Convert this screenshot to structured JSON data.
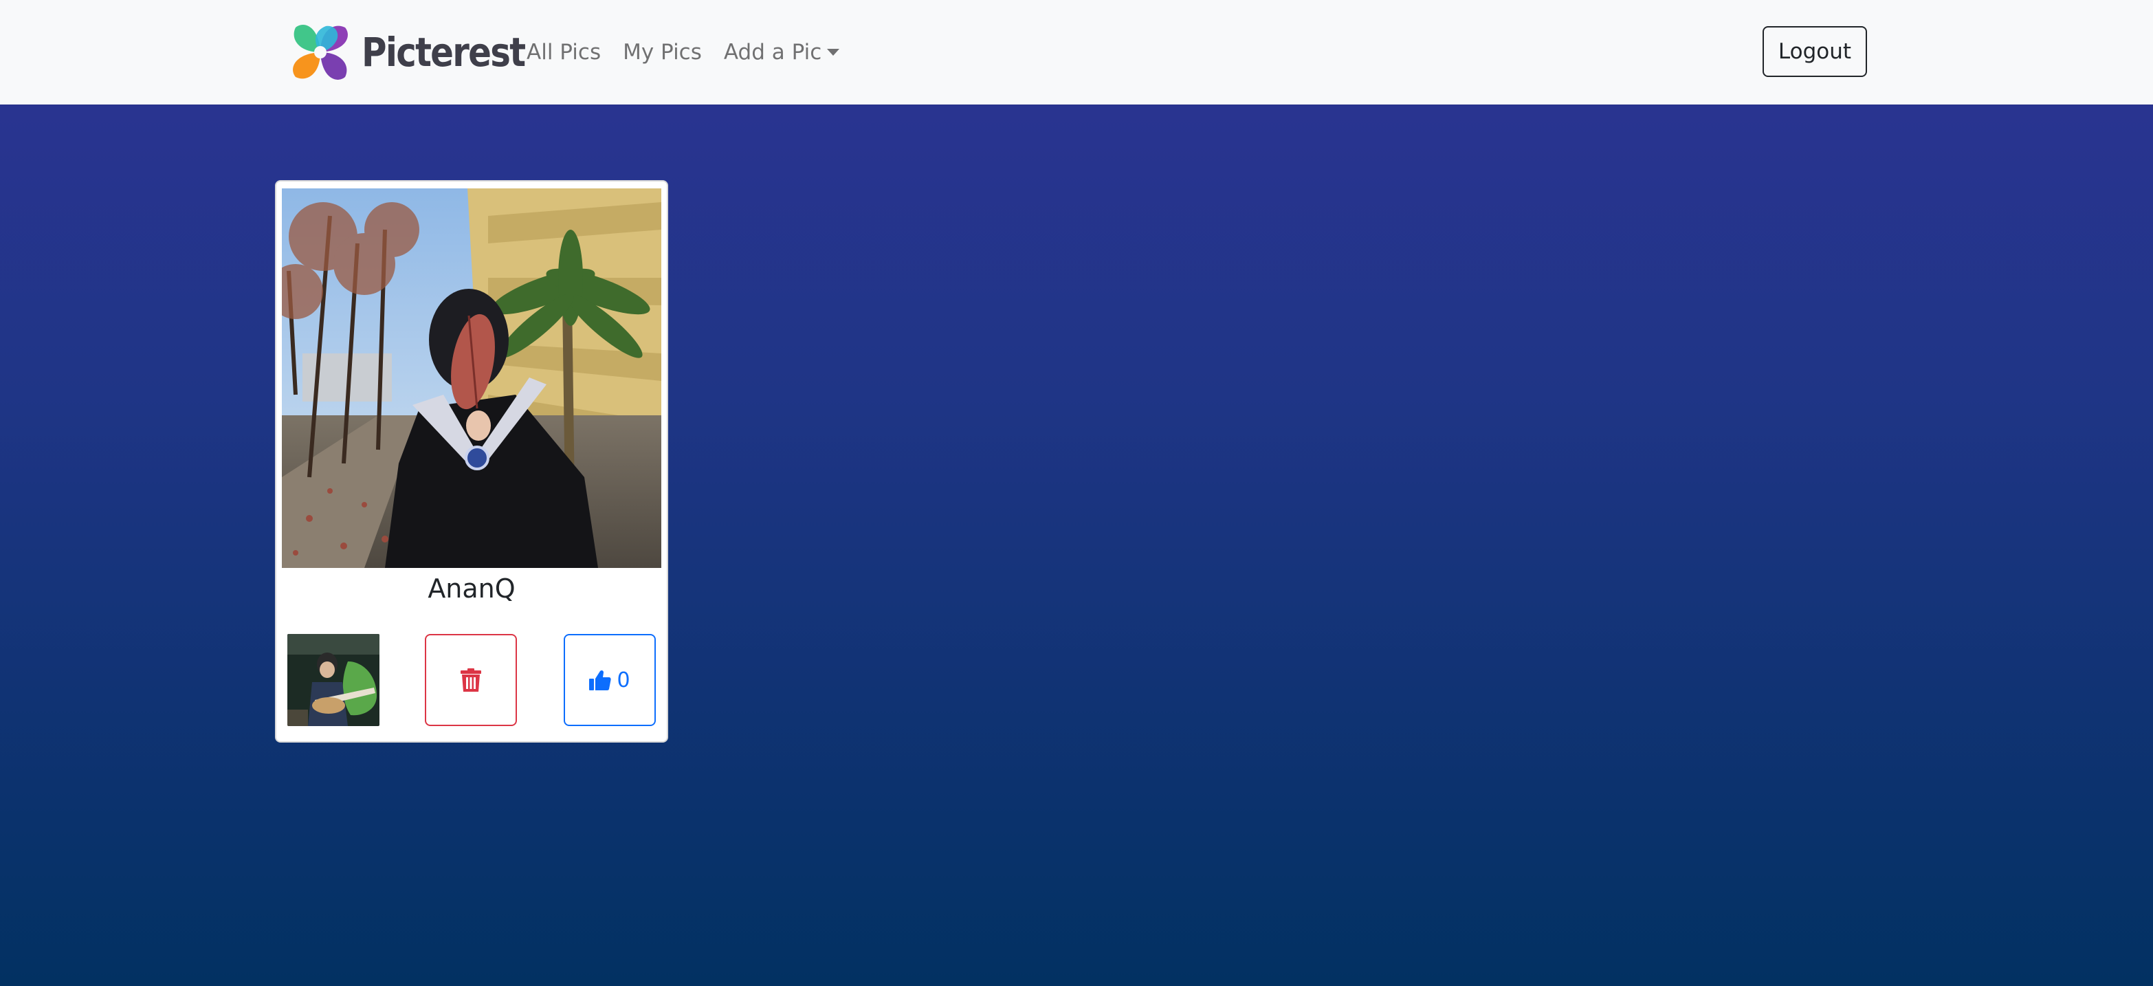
{
  "navbar": {
    "brand": "Picterest",
    "links": [
      {
        "label": "All Pics"
      },
      {
        "label": "My Pics"
      },
      {
        "label": "Add a Pic",
        "dropdown": true
      }
    ],
    "logout_label": "Logout"
  },
  "card": {
    "title": "AnanQ",
    "image_description_icon": "photo",
    "avatar_icon": "user-avatar",
    "delete_icon": "trash-icon",
    "like_icon": "thumbs-up-icon",
    "like_count": "0"
  },
  "colors": {
    "navbar_bg": "#f8f9fa",
    "page_gradient_top": "#2d3494",
    "page_gradient_bottom": "#023162",
    "danger": "#dc3545",
    "primary": "#0d6efd"
  }
}
